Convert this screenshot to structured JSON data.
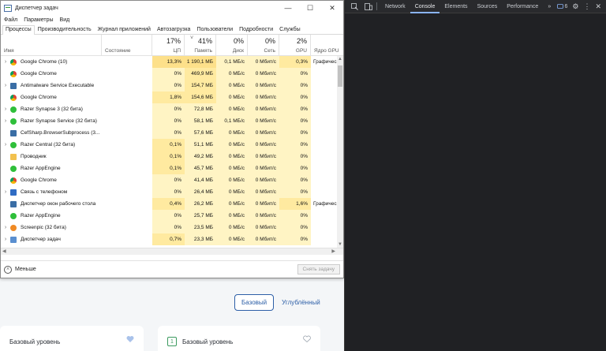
{
  "background_page": {
    "tab_basic": "Базовый",
    "tab_advanced": "Углублённый",
    "card1_title": "Базовый уровень",
    "card2_number": "1",
    "card2_title": "Базовый уровень"
  },
  "devtools": {
    "tabs": [
      "Network",
      "Console",
      "Elements",
      "Sources",
      "Performance"
    ],
    "active_tab": "Console",
    "more": "»",
    "issues_count": "6"
  },
  "task_manager": {
    "title": "Диспетчер задач",
    "window_controls": [
      "—",
      "☐",
      "✕"
    ],
    "menu": [
      "Файл",
      "Параметры",
      "Вид"
    ],
    "tabs": [
      "Процессы",
      "Производительность",
      "Журнал приложений",
      "Автозагрузка",
      "Пользователи",
      "Подробности",
      "Службы"
    ],
    "active_tab": "Процессы",
    "columns": {
      "name": "Имя",
      "status": "Состояние",
      "cpu": {
        "pct": "17%",
        "label": "ЦП"
      },
      "mem": {
        "pct": "41%",
        "label": "Память"
      },
      "disk": {
        "pct": "0%",
        "label": "Диск"
      },
      "net": {
        "pct": "0%",
        "label": "Сеть"
      },
      "gpu": {
        "pct": "2%",
        "label": "GPU"
      },
      "gpu_engine": "Ядро GPU"
    },
    "processes": [
      {
        "name": "Google Chrome (10)",
        "expand": true,
        "icon": "chrome-icon",
        "cpu": "13,3%",
        "mem": "1 190,1 МБ",
        "disk": "0,1 МБ/с",
        "net": "0 Мбит/с",
        "gpu": "0,3%",
        "engine": "Графическ"
      },
      {
        "name": "Google Chrome",
        "expand": false,
        "icon": "chrome-icon",
        "cpu": "0%",
        "mem": "469,9 МБ",
        "disk": "0 МБ/с",
        "net": "0 Мбит/с",
        "gpu": "0%",
        "engine": ""
      },
      {
        "name": "Antimalware Service Executable",
        "expand": true,
        "icon": "window-icon",
        "cpu": "0%",
        "mem": "154,7 МБ",
        "disk": "0 МБ/с",
        "net": "0 Мбит/с",
        "gpu": "0%",
        "engine": ""
      },
      {
        "name": "Google Chrome",
        "expand": false,
        "icon": "chrome-icon",
        "cpu": "1,8%",
        "mem": "154,6 МБ",
        "disk": "0 МБ/с",
        "net": "0 Мбит/с",
        "gpu": "0%",
        "engine": ""
      },
      {
        "name": "Razer Synapse 3 (32 бита)",
        "expand": true,
        "icon": "razer-icon",
        "cpu": "0%",
        "mem": "72,8 МБ",
        "disk": "0 МБ/с",
        "net": "0 Мбит/с",
        "gpu": "0%",
        "engine": ""
      },
      {
        "name": "Razer Synapse Service (32 бита)",
        "expand": true,
        "icon": "razer-icon",
        "cpu": "0%",
        "mem": "58,1 МБ",
        "disk": "0,1 МБ/с",
        "net": "0 Мбит/с",
        "gpu": "0%",
        "engine": ""
      },
      {
        "name": "CefSharp.BrowserSubprocess (3...",
        "expand": false,
        "icon": "window-icon",
        "cpu": "0%",
        "mem": "57,6 МБ",
        "disk": "0 МБ/с",
        "net": "0 Мбит/с",
        "gpu": "0%",
        "engine": ""
      },
      {
        "name": "Razer Central (32 бита)",
        "expand": true,
        "icon": "razer-icon",
        "cpu": "0,1%",
        "mem": "51,1 МБ",
        "disk": "0 МБ/с",
        "net": "0 Мбит/с",
        "gpu": "0%",
        "engine": ""
      },
      {
        "name": "Проводник",
        "expand": false,
        "icon": "folder-icon",
        "cpu": "0,1%",
        "mem": "49,2 МБ",
        "disk": "0 МБ/с",
        "net": "0 Мбит/с",
        "gpu": "0%",
        "engine": ""
      },
      {
        "name": "Razer AppEngine",
        "expand": false,
        "icon": "razer-icon",
        "cpu": "0,1%",
        "mem": "45,7 МБ",
        "disk": "0 МБ/с",
        "net": "0 Мбит/с",
        "gpu": "0%",
        "engine": ""
      },
      {
        "name": "Google Chrome",
        "expand": false,
        "icon": "chrome-icon",
        "cpu": "0%",
        "mem": "41,4 МБ",
        "disk": "0 МБ/с",
        "net": "0 Мбит/с",
        "gpu": "0%",
        "engine": ""
      },
      {
        "name": "Связь с телефоном",
        "expand": true,
        "icon": "phone-link-icon",
        "cpu": "0%",
        "mem": "26,4 МБ",
        "disk": "0 МБ/с",
        "net": "0 Мбит/с",
        "gpu": "0%",
        "engine": ""
      },
      {
        "name": "Диспетчер окон рабочего стола",
        "expand": false,
        "icon": "window-icon",
        "cpu": "0,4%",
        "mem": "26,2 МБ",
        "disk": "0 МБ/с",
        "net": "0 Мбит/с",
        "gpu": "1,6%",
        "engine": "Графическ"
      },
      {
        "name": "Razer AppEngine",
        "expand": false,
        "icon": "razer-icon",
        "cpu": "0%",
        "mem": "25,7 МБ",
        "disk": "0 МБ/с",
        "net": "0 Мбит/с",
        "gpu": "0%",
        "engine": ""
      },
      {
        "name": "Screenpic (32 бита)",
        "expand": true,
        "icon": "screenpic-icon",
        "cpu": "0%",
        "mem": "23,5 МБ",
        "disk": "0 МБ/с",
        "net": "0 Мбит/с",
        "gpu": "0%",
        "engine": ""
      },
      {
        "name": "Диспетчер задач",
        "expand": true,
        "icon": "task-manager-icon",
        "cpu": "0,7%",
        "mem": "23,3 МБ",
        "disk": "0 МБ/с",
        "net": "0 Мбит/с",
        "gpu": "0%",
        "engine": ""
      }
    ],
    "footer_less": "Меньше",
    "end_task": "Снять задачу"
  }
}
